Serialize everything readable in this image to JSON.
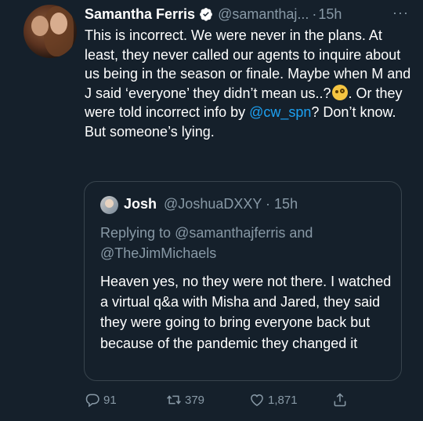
{
  "tweet": {
    "author_name": "Samantha Ferris",
    "handle": "@samanthaj...",
    "time": "15h",
    "more": "···",
    "text_part1": "This is incorrect. We were never in the plans. At least, they never called our agents to inquire about us being in the season or finale. Maybe when M and J said ‘everyone’ they didn’t mean us..?",
    "text_part2": ". Or they were told incorrect info by ",
    "mention": "@cw_spn",
    "text_part3": "? Don’t know. But someone’s lying."
  },
  "quote": {
    "author_name": "Josh",
    "handle": "@JoshuaDXXY",
    "time": "15h",
    "reply_prefix": "Replying to ",
    "reply_mention1": "@samanthajferris",
    "reply_and": " and ",
    "reply_mention2": "@TheJimMichaels",
    "text": "Heaven yes, no they were not there. I watched a virtual q&a with Misha and Jared, they said they were going to bring everyone back but because of the pandemic they changed it"
  },
  "actions": {
    "replies": "91",
    "retweets": "379",
    "likes": "1,871"
  },
  "colors": {
    "background": "#15202b",
    "secondary_text": "#8899a6",
    "link": "#1da1f2",
    "border": "#38444d"
  }
}
